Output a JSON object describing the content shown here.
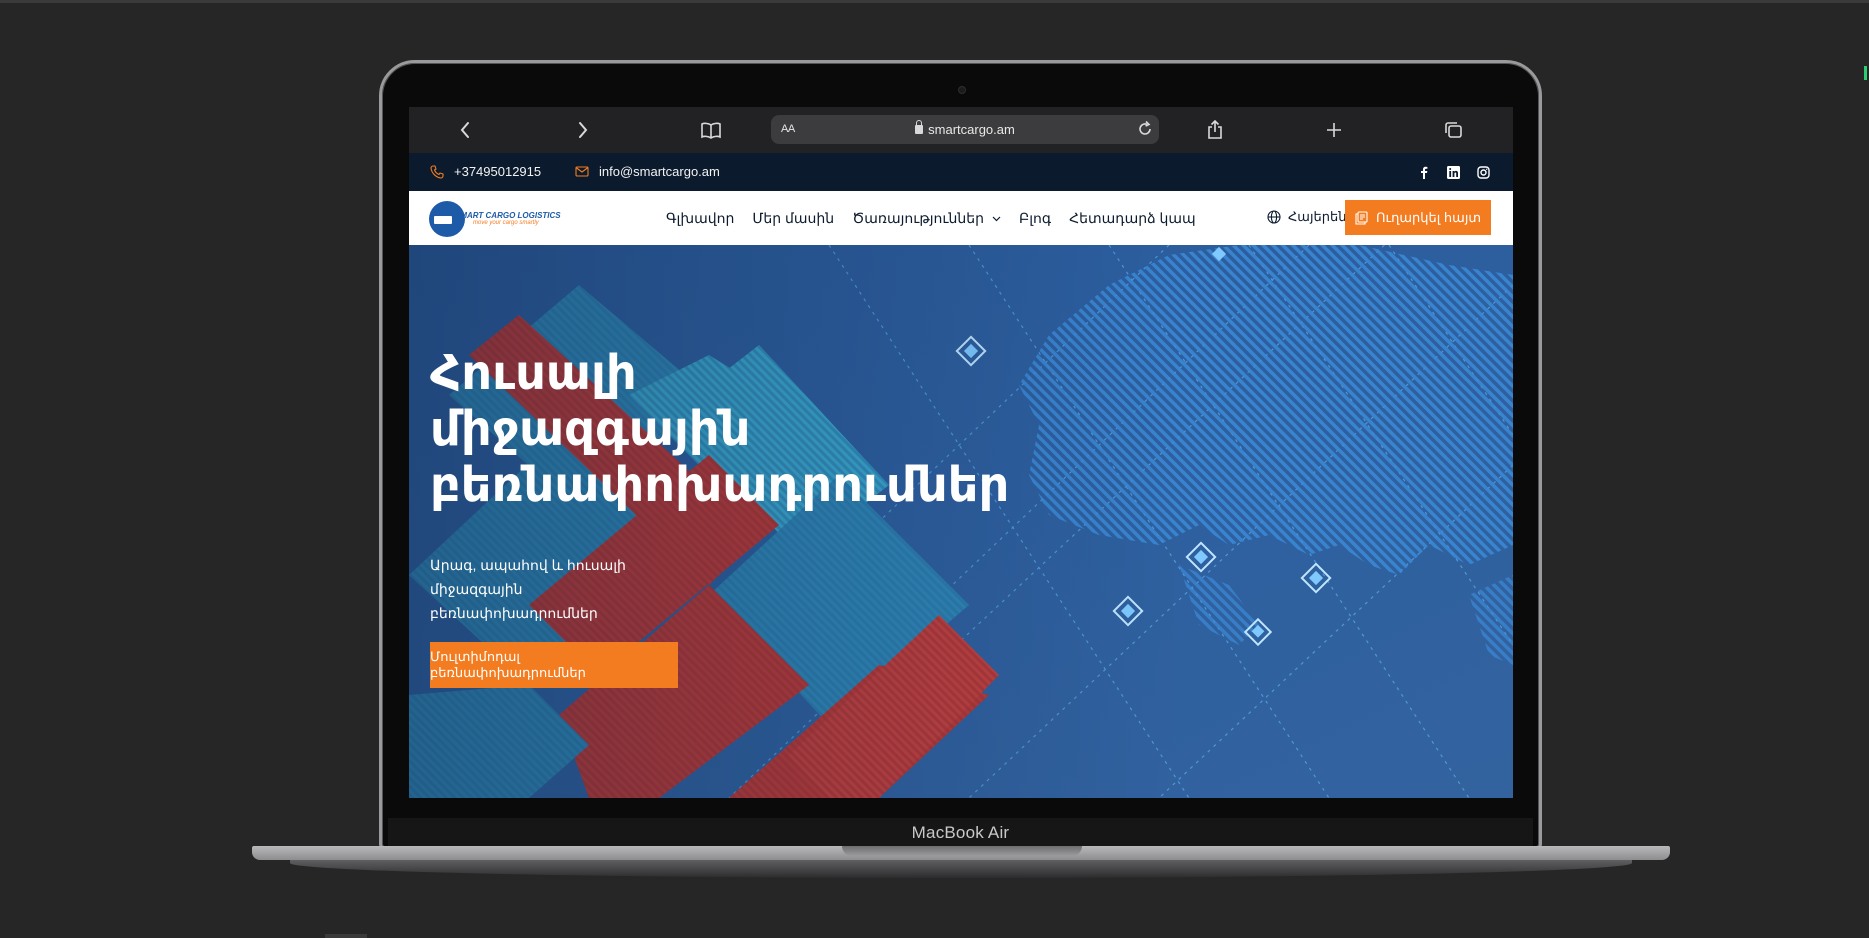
{
  "device": {
    "label": "MacBook Air"
  },
  "browser": {
    "url": "smartcargo.am",
    "text_size_label": "AA",
    "icons": [
      "back-icon",
      "forward-icon",
      "bookmarks-icon",
      "share-icon",
      "new-tab-icon",
      "tabs-icon",
      "reload-icon",
      "lock-icon"
    ]
  },
  "topbar": {
    "phone": "+37495012915",
    "email": "info@smartcargo.am",
    "social": [
      "facebook",
      "linkedin",
      "instagram"
    ]
  },
  "header": {
    "logo": {
      "name": "SMART CARGO LOGISTICS",
      "tagline": "move your cargo smartly"
    },
    "nav": [
      {
        "label": "Գլխավոր"
      },
      {
        "label": "Մեր մասին"
      },
      {
        "label": "Ծառայություններ"
      },
      {
        "label": "Բլոգ"
      },
      {
        "label": "Հետադարձ կապ"
      }
    ],
    "language": "Հայերեն",
    "cta_label": "Ուղարկել հայտ"
  },
  "hero": {
    "title_lines": [
      "Հուսալի",
      "միջազգային",
      "բեռնափոխադրումներ"
    ],
    "subtitle_lines": [
      "Արագ, ապահով և հուսալի",
      "միջազգային բեռնափոխադրումներ"
    ],
    "button_label": "Մուլտիմոդալ բեռնափոխադրումներ"
  },
  "colors": {
    "accent": "#f47c20",
    "topbar_bg": "#0b1a2d",
    "brand_blue": "#1d5ba8",
    "hero_blue": "#2c5c9a",
    "container_red": "#b83a3a",
    "container_blue": "#2f86b8"
  }
}
